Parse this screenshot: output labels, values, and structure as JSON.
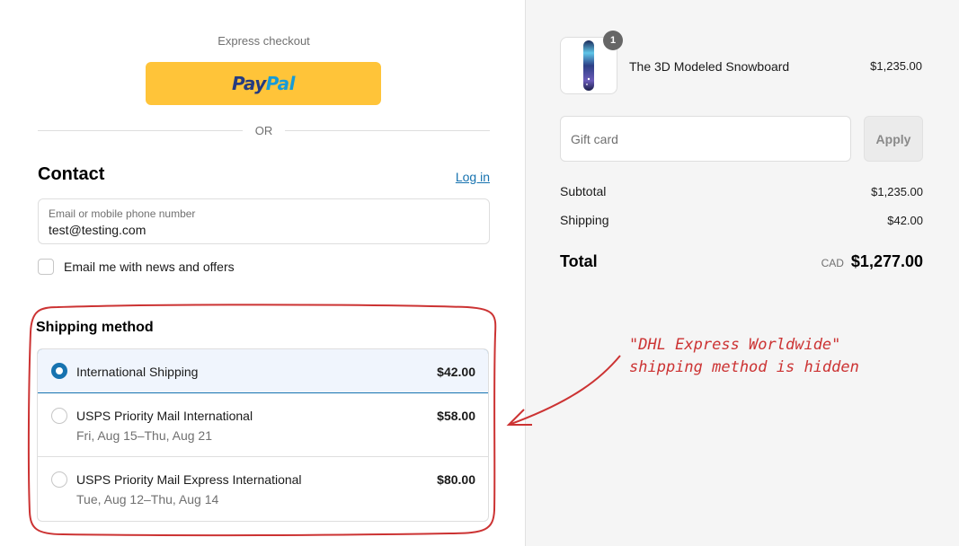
{
  "express": {
    "label": "Express checkout",
    "paypal_part1": "Pay",
    "paypal_part2": "Pal",
    "or_label": "OR"
  },
  "contact": {
    "title": "Contact",
    "login_label": "Log in",
    "email_label": "Email or mobile phone number",
    "email_value": "test@testing.com",
    "news_label": "Email me with news and offers"
  },
  "shipping": {
    "title": "Shipping method",
    "options": [
      {
        "name": "International Shipping",
        "dates": "",
        "price": "$42.00",
        "selected": true
      },
      {
        "name": "USPS Priority Mail International",
        "dates": "Fri, Aug 15–Thu, Aug 21",
        "price": "$58.00",
        "selected": false
      },
      {
        "name": "USPS Priority Mail Express International",
        "dates": "Tue, Aug 12–Thu, Aug 14",
        "price": "$80.00",
        "selected": false
      }
    ]
  },
  "summary": {
    "product_qty": "1",
    "product_name": "The 3D Modeled Snowboard",
    "product_price": "$1,235.00",
    "gift_placeholder": "Gift card",
    "apply_label": "Apply",
    "subtotal_label": "Subtotal",
    "subtotal_value": "$1,235.00",
    "shipping_label": "Shipping",
    "shipping_value": "$42.00",
    "total_label": "Total",
    "currency": "CAD",
    "total_value": "$1,277.00"
  },
  "annotation": {
    "line1": "\"DHL Express Worldwide\"",
    "line2": "shipping method is hidden",
    "color": "#cc3333"
  },
  "colors": {
    "accent": "#1773b0",
    "paypal_yellow": "#ffc439",
    "sidebar_bg": "#f5f5f5"
  }
}
